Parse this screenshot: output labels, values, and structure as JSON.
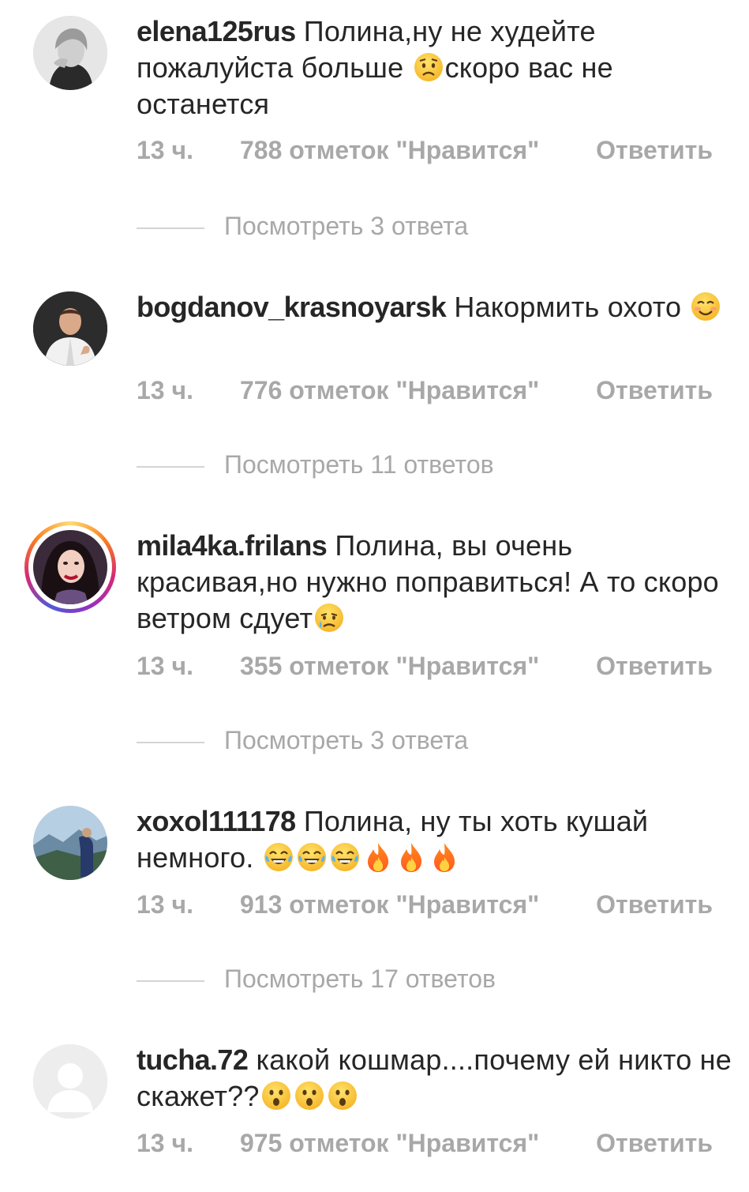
{
  "labels": {
    "likes_suffix": "отметок \"Нравится\"",
    "reply": "Ответить"
  },
  "comments": [
    {
      "username": "elena125rus",
      "text_parts": [
        "Полина,ну не худейте пожалуйста больше ",
        "скоро вас не останется"
      ],
      "time": "13 ч.",
      "likes": "788 отметок \"Нравится\"",
      "reply": "Ответить",
      "view_replies": "Посмотреть 3 ответа"
    },
    {
      "username": "bogdanov_krasnoyarsk",
      "text_parts": [
        "Накормить охото "
      ],
      "time": "13 ч.",
      "likes": "776 отметок \"Нравится\"",
      "reply": "Ответить",
      "view_replies": "Посмотреть 11 ответов"
    },
    {
      "username": "mila4ka.frilans",
      "text_parts": [
        "Полина, вы очень красивая,но нужно поправиться! А то скоро ветром сдует"
      ],
      "time": "13 ч.",
      "likes": "355 отметок \"Нравится\"",
      "reply": "Ответить",
      "view_replies": "Посмотреть 3 ответа"
    },
    {
      "username": "xoxol111178",
      "text_parts": [
        "Полина, ну ты хоть кушай немного. "
      ],
      "time": "13 ч.",
      "likes": "913 отметок \"Нравится\"",
      "reply": "Ответить",
      "view_replies": "Посмотреть 17 ответов"
    },
    {
      "username": "tucha.72",
      "text_parts": [
        "какой кошмар....почему ей никто не скажет??"
      ],
      "time": "13 ч.",
      "likes": "975 отметок \"Нравится\"",
      "reply": "Ответить"
    }
  ],
  "emoji_names": {
    "worried": "worried-face-emoji",
    "blush": "smiling-blush-face-emoji",
    "cry": "crying-face-emoji",
    "joy": "tears-of-joy-emoji",
    "fire": "fire-emoji",
    "astonished": "astonished-face-emoji"
  },
  "colors": {
    "text": "#262626",
    "muted": "#a8a8a8",
    "divider": "#d4d4d4",
    "emoji_yellow": "#f7c531",
    "story_ring": "#d62976"
  }
}
